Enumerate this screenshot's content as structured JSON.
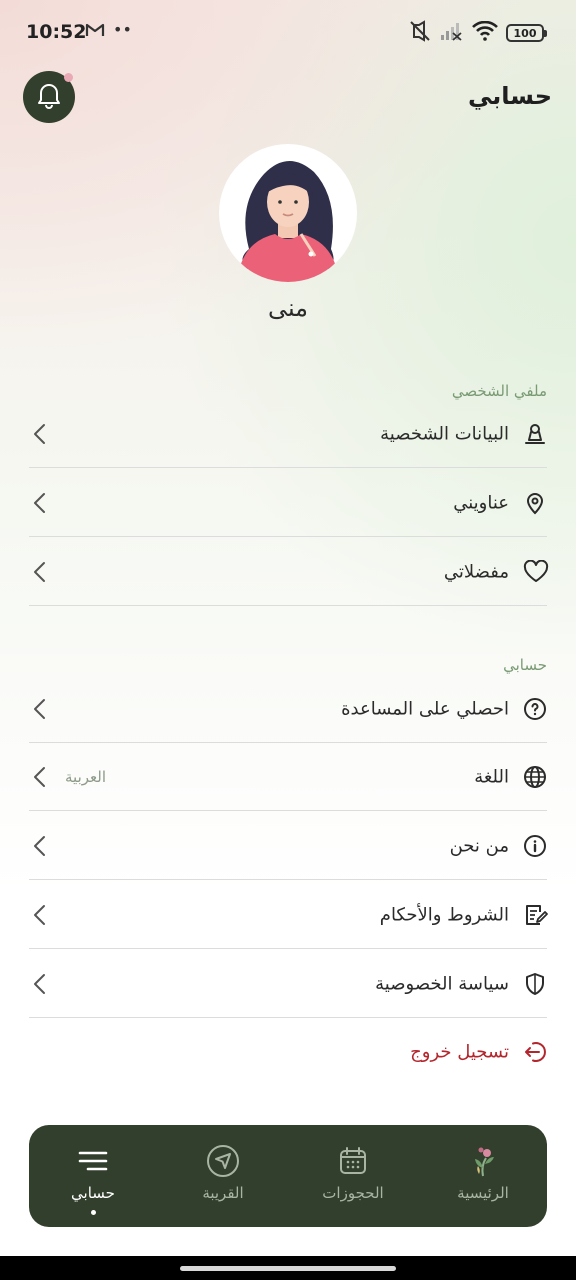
{
  "status": {
    "time": "10:52",
    "dots": "••",
    "battery": "100"
  },
  "header": {
    "title": "حسابي"
  },
  "profile": {
    "name": "منى"
  },
  "sections": {
    "profile_label": "ملفي الشخصي",
    "account_label": "حسابي"
  },
  "menu": {
    "personal_data": "البيانات الشخصية",
    "addresses": "عناويني",
    "favorites": "مفضلاتي",
    "help": "احصلي على المساعدة",
    "language": "اللغة",
    "language_value": "العربية",
    "about": "من نحن",
    "terms": "الشروط والأحكام",
    "privacy": "سياسة الخصوصية",
    "logout": "تسجيل خروج"
  },
  "nav": {
    "home": "الرئيسية",
    "bookings": "الحجوزات",
    "nearby": "القريبة",
    "account": "حسابي"
  },
  "colors": {
    "accent_dark": "#323f2c",
    "section_label": "#7a9a74",
    "logout": "#b3262d"
  },
  "icons": {
    "bell": "bell-icon",
    "personal": "person-icon",
    "address": "location-pin-icon",
    "favorite": "heart-icon",
    "help": "question-icon",
    "language": "globe-icon",
    "about": "info-icon",
    "terms": "document-edit-icon",
    "privacy": "shield-icon",
    "logout": "logout-icon"
  }
}
